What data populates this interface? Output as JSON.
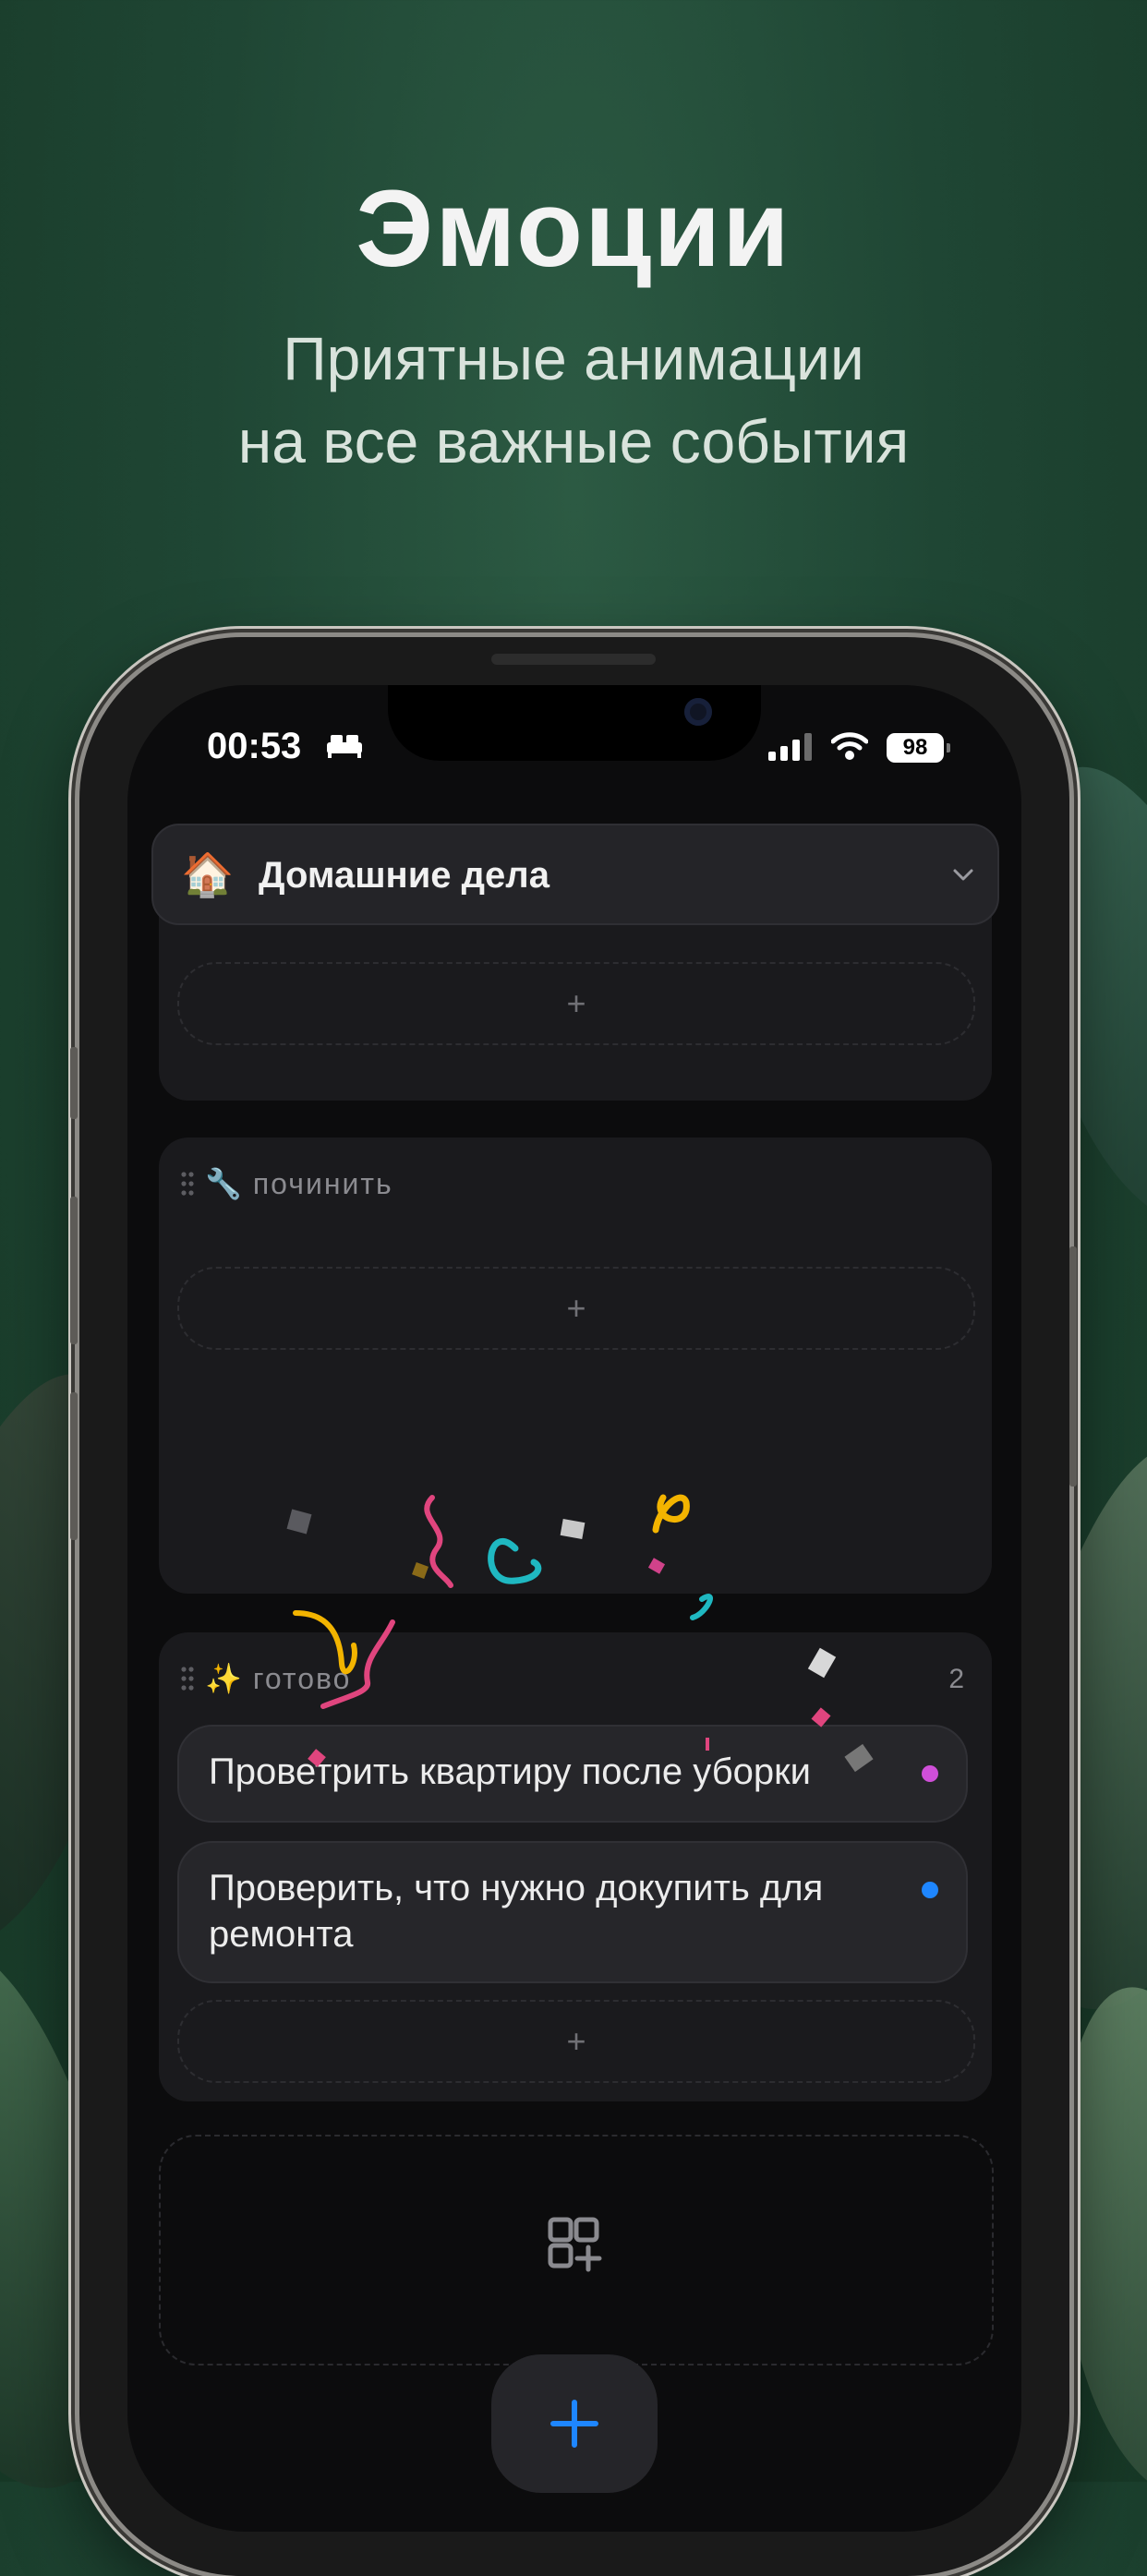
{
  "promo": {
    "title": "Эмоции",
    "subtitle_line1": "Приятные анимации",
    "subtitle_line2": "на все важные события"
  },
  "status_bar": {
    "time": "00:53",
    "battery": "98"
  },
  "project": {
    "emoji": "🏠",
    "name": "Домашние дела"
  },
  "columns": [
    {
      "emoji": "🔧",
      "title": "починить",
      "add_label": "+"
    },
    {
      "emoji": "✨",
      "title": "готово",
      "count": "2",
      "add_label": "+",
      "tasks": [
        {
          "text": "Проветрить квартиру после уборки",
          "color": "#cf4fd8"
        },
        {
          "text": "Проверить, что нужно докупить для ремонта",
          "color": "#1e86ff"
        }
      ]
    }
  ],
  "top_column_add_label": "+",
  "accent_color": "#1e86ff",
  "icons": [
    "bed-icon",
    "signal-icon",
    "wifi-icon",
    "chevron-down-icon",
    "drag-handle-icon",
    "add-board-icon",
    "plus-icon"
  ]
}
